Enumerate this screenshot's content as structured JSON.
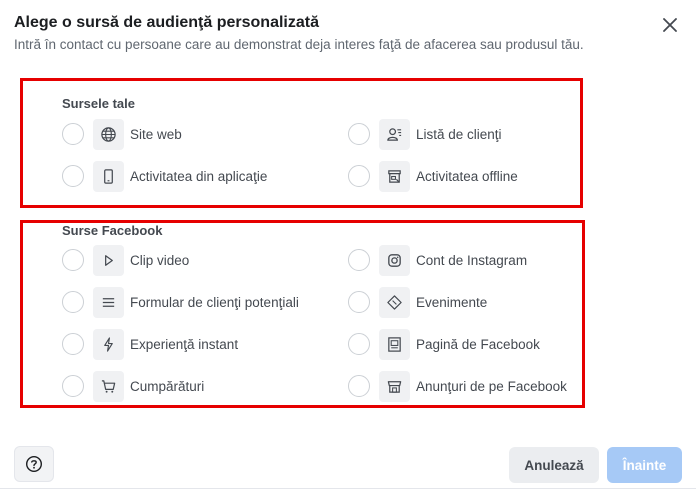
{
  "header": {
    "title": "Alege o sursă de audienţă personalizată",
    "subtitle": "Intră în contact cu persoane care au demonstrat deja interes faţă de afacerea sau produsul tău."
  },
  "sections": {
    "your_sources": {
      "title": "Sursele tale",
      "items": [
        {
          "label": "Site web",
          "icon": "globe-icon"
        },
        {
          "label": "Listă de clienţi",
          "icon": "customer-list-icon"
        },
        {
          "label": "Activitatea din aplicaţie",
          "icon": "mobile-app-icon"
        },
        {
          "label": "Activitatea offline",
          "icon": "store-icon"
        }
      ]
    },
    "facebook_sources": {
      "title": "Surse Facebook",
      "items": [
        {
          "label": "Clip video",
          "icon": "play-icon"
        },
        {
          "label": "Cont de Instagram",
          "icon": "instagram-icon"
        },
        {
          "label": "Formular de clienţi potenţiali",
          "icon": "form-lines-icon"
        },
        {
          "label": "Evenimente",
          "icon": "ticket-icon"
        },
        {
          "label": "Experienţă instant",
          "icon": "lightning-icon"
        },
        {
          "label": "Pagină de Facebook",
          "icon": "page-icon"
        },
        {
          "label": "Cumpărături",
          "icon": "cart-icon"
        },
        {
          "label": "Anunţuri de pe Facebook",
          "icon": "marketplace-icon"
        }
      ]
    }
  },
  "footer": {
    "help_icon": "question-circle-icon",
    "cancel_label": "Anulează",
    "next_label": "Înainte"
  },
  "colors": {
    "highlight_border": "#e60000",
    "next_button_disabled": "#a6c9f6",
    "cancel_button": "#ebedf0"
  }
}
